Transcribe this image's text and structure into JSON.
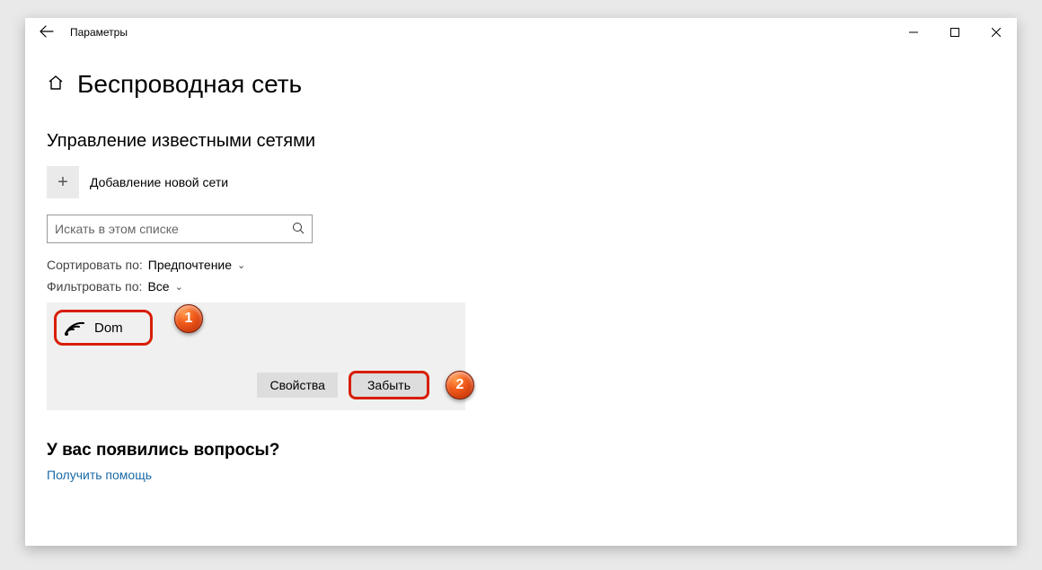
{
  "window": {
    "title": "Параметры"
  },
  "page": {
    "title": "Беспроводная сеть",
    "section": "Управление известными сетями"
  },
  "add_network": {
    "label": "Добавление новой сети"
  },
  "search": {
    "placeholder": "Искать в этом списке"
  },
  "sort": {
    "label": "Сортировать по:",
    "value": "Предпочтение"
  },
  "filter": {
    "label": "Фильтровать по:",
    "value": "Все"
  },
  "network": {
    "name": "Dom"
  },
  "actions": {
    "properties": "Свойства",
    "forget": "Забыть"
  },
  "help": {
    "heading": "У вас появились вопросы?",
    "link": "Получить помощь"
  },
  "markers": {
    "one": "1",
    "two": "2"
  }
}
